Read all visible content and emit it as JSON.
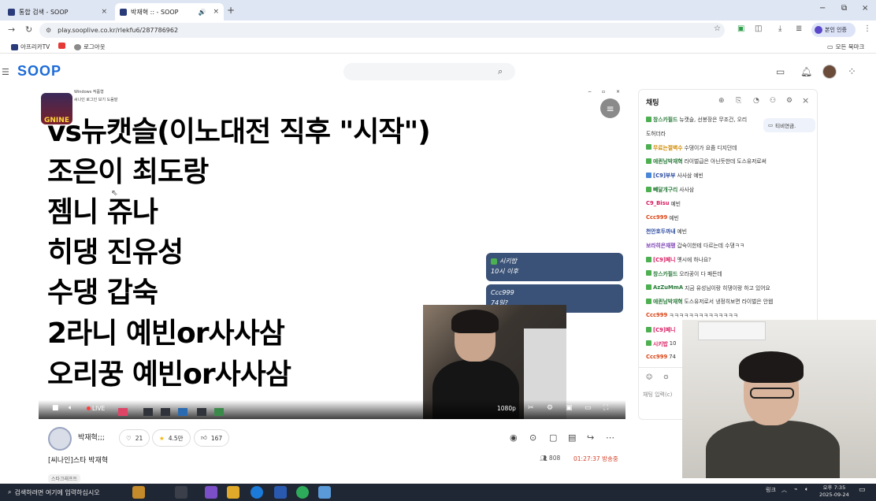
{
  "browser": {
    "tabs": [
      {
        "title": "통합 검색 - SOOP",
        "close": "×"
      },
      {
        "title": "박재혁 :: - SOOP",
        "close": "×"
      }
    ],
    "new_tab": "+",
    "window_controls": [
      "−",
      "⧉",
      "×"
    ],
    "url": "play.sooplive.co.kr/rlekfu6/287786962",
    "profile_label": "본인 인증",
    "bookmarks": [
      {
        "label": "아프리카TV",
        "color": "#2a3b7a"
      },
      {
        "label": "",
        "color": "#e53935"
      },
      {
        "label": "로그아웃",
        "color": "#8a8a8a"
      }
    ],
    "all_bookmarks": "모든 북마크"
  },
  "site": {
    "logo": "SOOP",
    "search_placeholder": ""
  },
  "player": {
    "lines": [
      "vs뉴캣슬(이노대전 직후 \"시작\")",
      "조은이 최도랑",
      "젬니 쥬나",
      "히댕 진유성",
      "수댕 갑숙",
      "2라니 예빈or사사삼",
      "오리꿍 예빈or사사삼"
    ],
    "mini_window_title": "Windows 작품형",
    "mini_window_menu": "씨나인 로그인 보기 도움말",
    "badge_text": "GNINE",
    "chat_bubbles": [
      {
        "nick": "시키밥",
        "text": "10시 이후"
      },
      {
        "nick": "Ccc999",
        "text": "74일?"
      }
    ],
    "live_label": "LIVE",
    "quality_label": "1080p"
  },
  "stream": {
    "streamer_name": "박재혁;;;",
    "subscribe_count": "21",
    "star_count": "4.5만",
    "like_count": "167",
    "title": "[씨나인]스타 박재혁",
    "viewers": "808",
    "uptime": "01:27:37 방송중",
    "tag": "스타크래프트"
  },
  "chat": {
    "title": "채팅",
    "tooltip": "티비연금.",
    "input_placeholder": "채팅 입력(c)",
    "messages": [
      {
        "nick": "창스카필드",
        "text": "뉴캣슬, 선봉장은 무조건, 오리",
        "nick_color": "#2a7a3a",
        "badge": "#4caf50"
      },
      {
        "nick": "",
        "text": "도허더라",
        "nick_color": "#333",
        "badge": ""
      },
      {
        "nick": "무료는절벽수",
        "text": "수댕이가 요즘 디지던데",
        "nick_color": "#d08a00",
        "badge": "#4caf50"
      },
      {
        "nick": "에퀸남박재혁",
        "text": "라이벌급은 아닌듯한데 도스유저로써",
        "nick_color": "#2a7a3a",
        "badge": "#4caf50"
      },
      {
        "nick": "[C9]부부",
        "text": "사사삼 예빈",
        "nick_color": "#2a4aa0",
        "badge": "#4a86d8"
      },
      {
        "nick": "빼달개구리",
        "text": "사사삼",
        "nick_color": "#2a7a3a",
        "badge": "#4caf50"
      },
      {
        "nick": "C9_Bisu",
        "text": "예빈",
        "nick_color": "#d81b60",
        "badge": ""
      },
      {
        "nick": "Ccc999",
        "text": "예빈",
        "nick_color": "#d84315",
        "badge": ""
      },
      {
        "nick": "천안호두까내",
        "text": "예빈",
        "nick_color": "#2a4aa0",
        "badge": ""
      },
      {
        "nick": "보라히은재평",
        "text": "갑숙이한테 다르는데 수댕ㅋㅋ",
        "nick_color": "#7b3fb5",
        "badge": ""
      },
      {
        "nick": "[C9]페니",
        "text": "옛시에 하나요?",
        "nick_color": "#d81b60",
        "badge": "#4caf50"
      },
      {
        "nick": "창스카필드",
        "text": "오라꿍이 다 패든데",
        "nick_color": "#2a7a3a",
        "badge": "#4caf50"
      },
      {
        "nick": "AzZuMmA",
        "text": "지금 유성님이랑 히댕이랑 하고 있어요",
        "nick_color": "#2a7a3a",
        "badge": "#4caf50"
      },
      {
        "nick": "에퀸남박재혁",
        "text": "도스유저로서 냉정히보면 라이벌은 안웹",
        "nick_color": "#2a7a3a",
        "badge": "#4caf50"
      },
      {
        "nick": "Ccc999",
        "text": "ㅋㅋㅋㅋㅋㅋㅋㅋㅋㅋㅋㅋㅋㅋ",
        "nick_color": "#d84315",
        "badge": ""
      },
      {
        "nick": "[C9]페니",
        "text": "",
        "nick_color": "#d81b60",
        "badge": "#4caf50"
      },
      {
        "nick": "시키밥",
        "text": "10",
        "nick_color": "#d81b60",
        "badge": "#4caf50"
      },
      {
        "nick": "Ccc999",
        "text": "74",
        "nick_color": "#d84315",
        "badge": ""
      }
    ]
  },
  "taskbar": {
    "search_placeholder": "검색하려면 여기에 입력하십시오",
    "tray_label": "링크",
    "time": "오후 7:35",
    "date": "2025-09-24"
  }
}
